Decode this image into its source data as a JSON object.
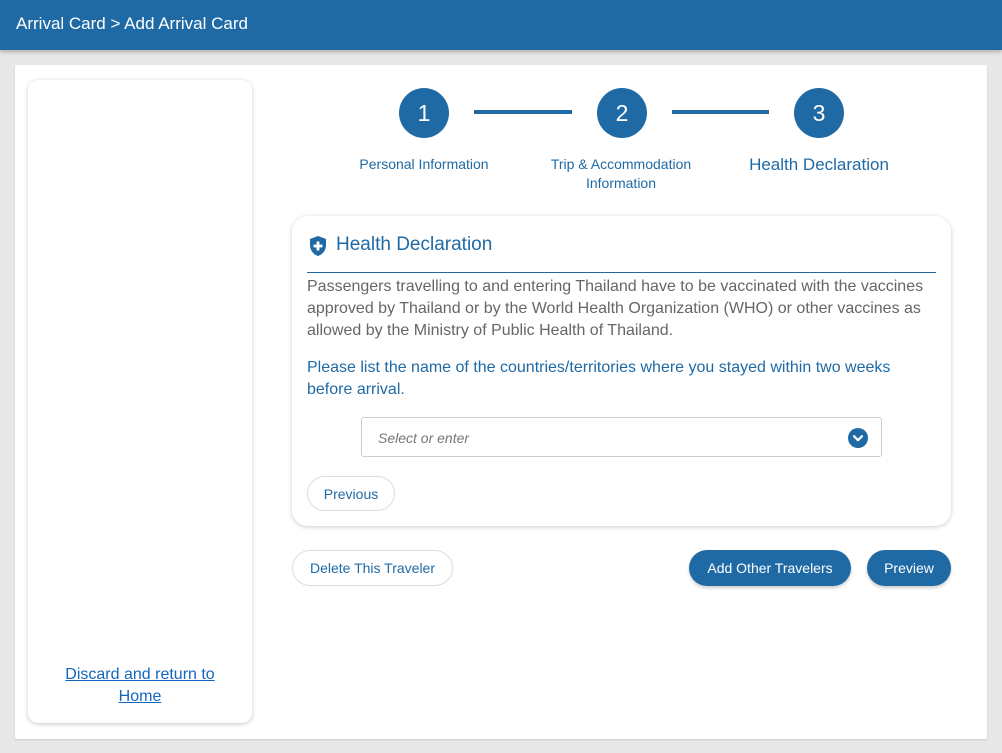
{
  "header": {
    "breadcrumb": "Arrival Card > Add Arrival Card"
  },
  "sidebar": {
    "discard_label": "Discard and return to Home"
  },
  "steps": [
    {
      "number": "1",
      "label": "Personal Information"
    },
    {
      "number": "2",
      "label": "Trip & Accommodation Information"
    },
    {
      "number": "3",
      "label": "Health Declaration"
    }
  ],
  "health": {
    "icon": "shield-plus-icon",
    "title": "Health Declaration",
    "description": "Passengers travelling to and entering Thailand have to be vaccinated with the vaccines approved by Thailand or by the World Health Organization (WHO) or other vaccines as allowed by the Ministry of Public Health of Thailand.",
    "question": "Please list the name of the countries/territories where you stayed within two weeks before arrival.",
    "country_select": {
      "placeholder": "Select or enter",
      "value": ""
    },
    "previous_label": "Previous"
  },
  "actions": {
    "delete_label": "Delete This Traveler",
    "add_travelers_label": "Add Other Travelers",
    "preview_label": "Preview"
  },
  "colors": {
    "primary": "#1f6aa5",
    "link": "#1565c0",
    "background": "#e8e8e8"
  }
}
